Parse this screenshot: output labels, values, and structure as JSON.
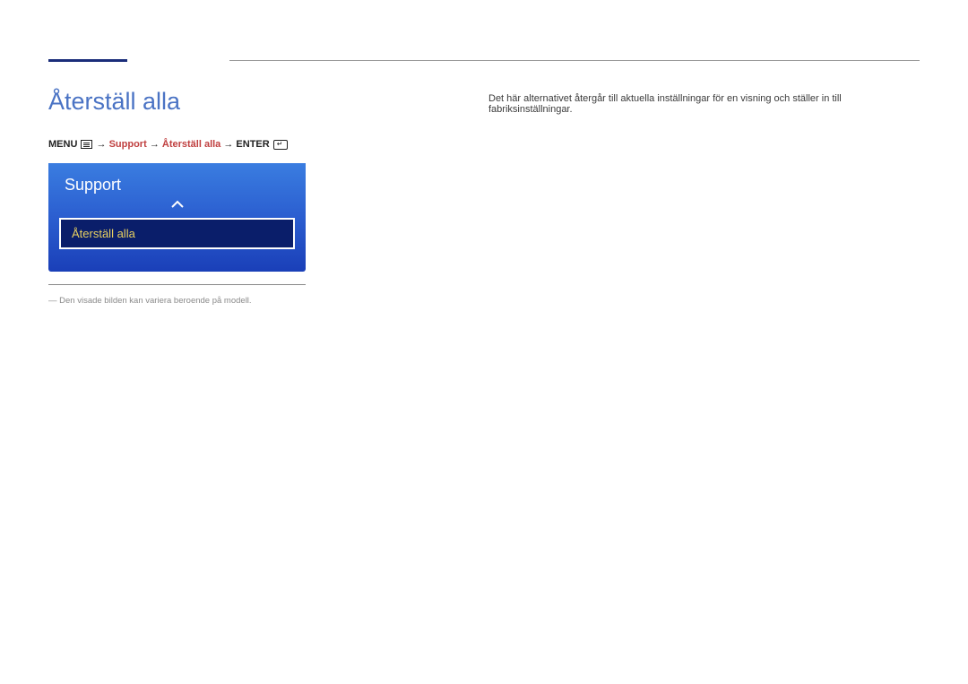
{
  "heading": "Återställ alla",
  "description": "Det här alternativet återgår till aktuella inställningar för en visning och ställer in till fabriksinställningar.",
  "breadcrumb": {
    "menu_label": "MENU",
    "support": "Support",
    "reset_all": "Återställ alla",
    "enter_label": "ENTER"
  },
  "menu_panel": {
    "title": "Support",
    "selected_item": "Återställ alla"
  },
  "footnote": "Den visade bilden kan variera beroende på modell."
}
